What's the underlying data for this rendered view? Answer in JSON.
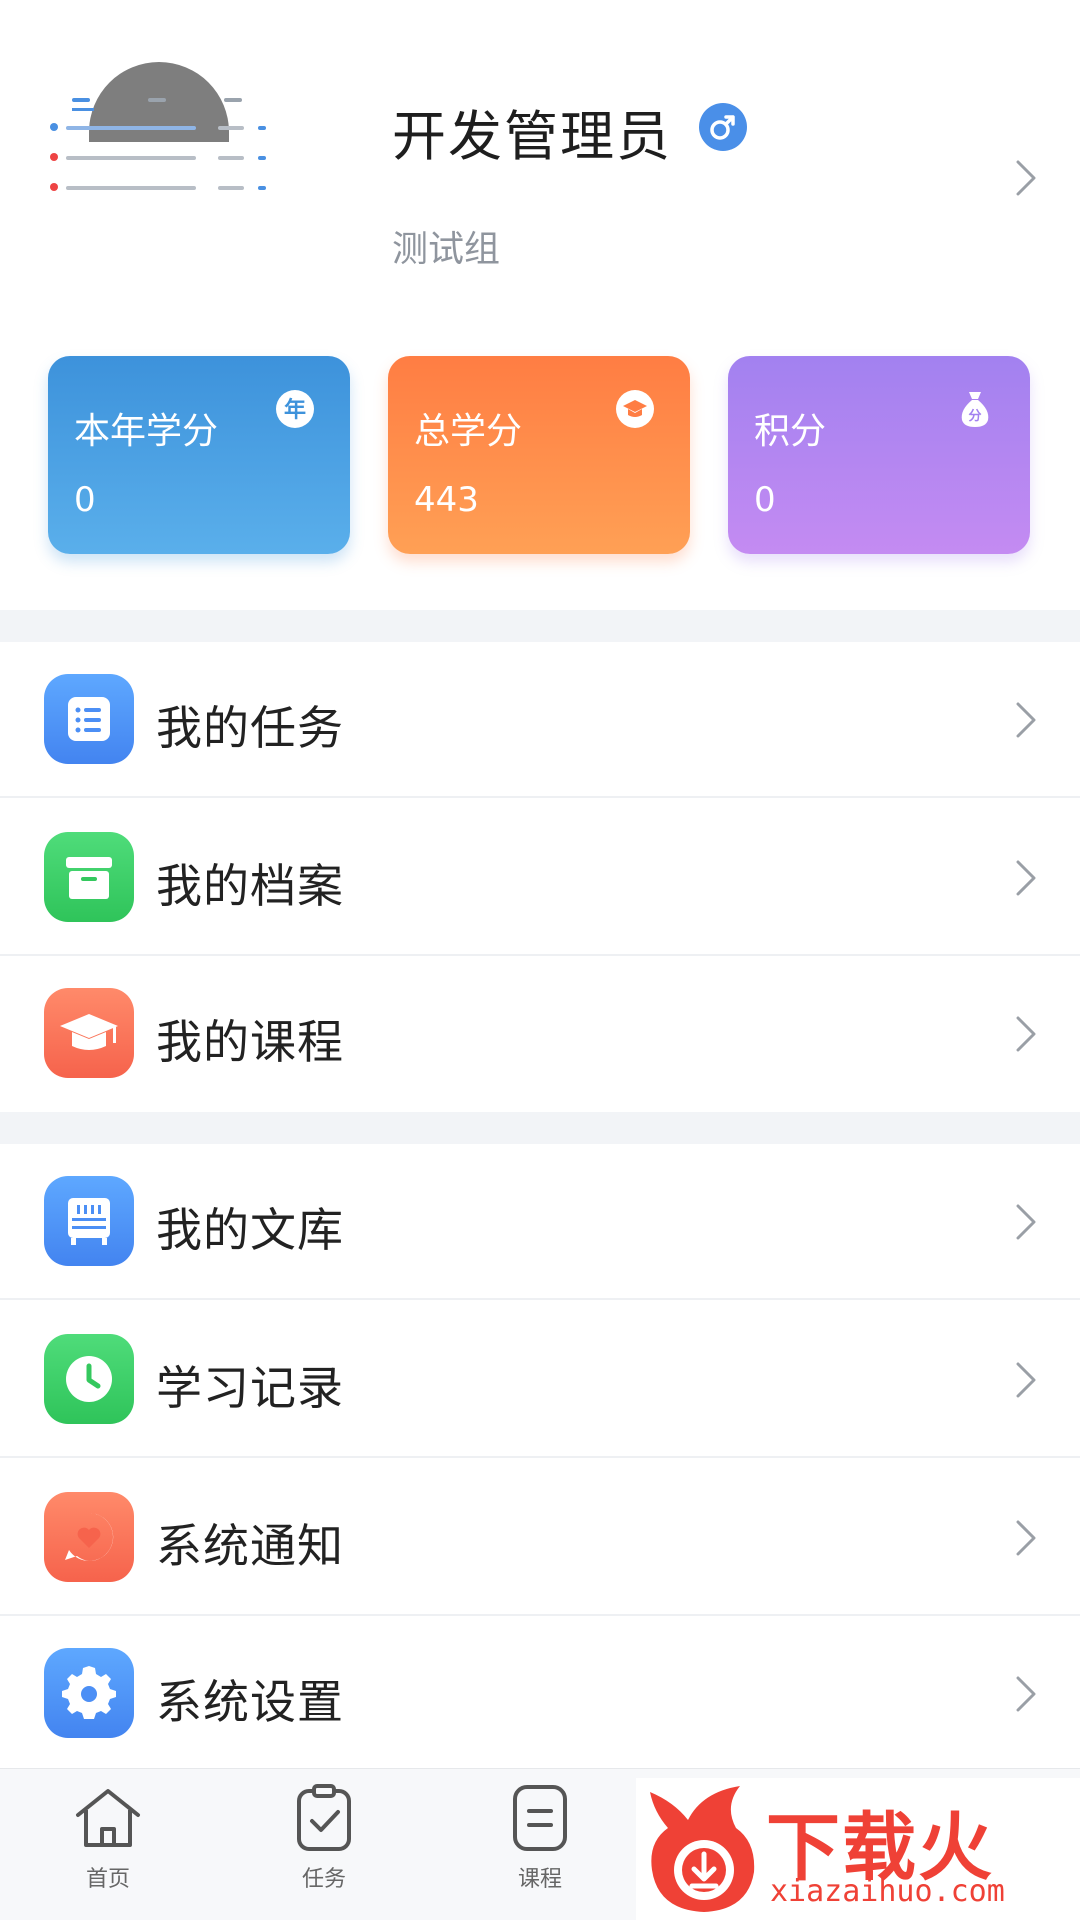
{
  "profile": {
    "name": "开发管理员",
    "group": "测试组",
    "gender_icon": "male-icon",
    "accent": "#4a8fe8"
  },
  "stats": [
    {
      "label": "本年学分",
      "value": "0",
      "icon": "year-badge-icon",
      "icon_text": "年",
      "color": "#3d92db"
    },
    {
      "label": "总学分",
      "value": "443",
      "icon": "graduation-cap-icon",
      "color": "#ff7d43"
    },
    {
      "label": "积分",
      "value": "0",
      "icon": "money-bag-icon",
      "icon_text": "分",
      "color": "#a281f0"
    }
  ],
  "menu_group_1": [
    {
      "label": "我的任务",
      "icon": "task-list-icon",
      "color": "#4c8ff5"
    },
    {
      "label": "我的档案",
      "icon": "archive-box-icon",
      "color": "#34c85e"
    },
    {
      "label": "我的课程",
      "icon": "graduation-cap-icon",
      "color": "#f6634c"
    }
  ],
  "menu_group_2": [
    {
      "label": "我的文库",
      "icon": "library-shelf-icon",
      "color": "#4c8ff5"
    },
    {
      "label": "学习记录",
      "icon": "clock-icon",
      "color": "#34c85e"
    },
    {
      "label": "系统通知",
      "icon": "heart-message-icon",
      "color": "#f6634c"
    },
    {
      "label": "系统设置",
      "icon": "gear-icon",
      "color": "#4c8ff5"
    }
  ],
  "bottom_nav": [
    {
      "label": "首页",
      "icon": "home-icon"
    },
    {
      "label": "任务",
      "icon": "clipboard-check-icon"
    },
    {
      "label": "课程",
      "icon": "document-icon"
    }
  ],
  "watermark": {
    "text": "下载火",
    "url": "xiazaihuo.com",
    "color": "#ef4136"
  }
}
